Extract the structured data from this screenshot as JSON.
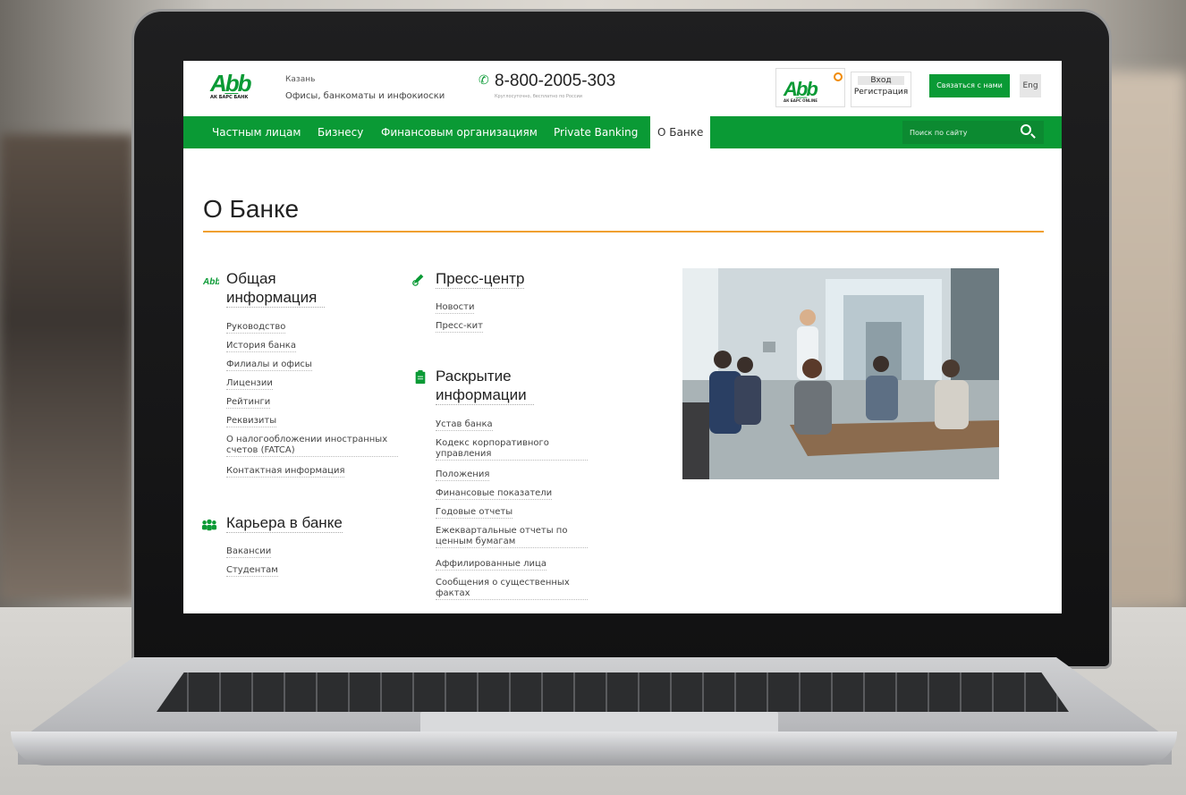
{
  "header": {
    "logo_text": "АК БАРС БАНК",
    "city": "Казань",
    "offices_link": "Офисы, банкоматы и инфокиоски",
    "phone": "8-800-2005-303",
    "phone_note": "Круглосуточно, бесплатно по России",
    "online_logo_text": "АК БАРС ONLINE",
    "login_label": "Вход",
    "register_label": "Регистрация",
    "contact_button": "Связаться с нами",
    "lang_button": "Eng"
  },
  "nav": {
    "items": [
      "Частным лицам",
      "Бизнесу",
      "Финансовым организациям",
      "Private Banking",
      "О Банке"
    ],
    "active": "О Банке",
    "search_placeholder": "Поиск по сайту"
  },
  "main": {
    "title": "О Банке",
    "sections": [
      {
        "title": "Общая информация",
        "icon": "logo-icon",
        "links": [
          "Руководство",
          "История банка",
          "Филиалы и офисы",
          "Лицензии",
          "Рейтинги",
          "Реквизиты",
          "О налогообложении иностранных счетов (FATCA)",
          "Контактная информация"
        ]
      },
      {
        "title": "Карьера в банке",
        "icon": "people-icon",
        "links": [
          "Вакансии",
          "Студентам"
        ]
      },
      {
        "title": "Пресс-центр",
        "icon": "pen-icon",
        "links": [
          "Новости",
          "Пресс-кит"
        ]
      },
      {
        "title": "Раскрытие информации",
        "icon": "clipboard-icon",
        "links": [
          "Устав банка",
          "Кодекс корпоративного управления",
          "Положения",
          "Финансовые показатели",
          "Годовые отчеты",
          "Ежеквартальные отчеты по ценным бумагам",
          "Аффилированные лица",
          "Сообщения о существенных фактах"
        ]
      }
    ]
  },
  "colors": {
    "brand_green": "#0a9a35",
    "accent_orange": "#f0a030"
  }
}
